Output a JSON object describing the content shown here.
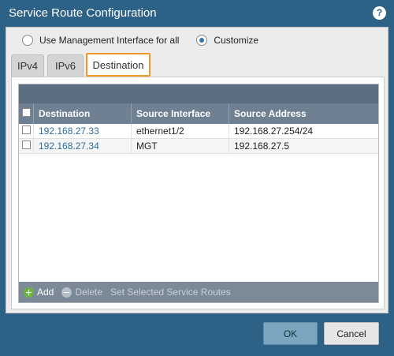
{
  "title": "Service Route Configuration",
  "help_icon": "?",
  "options": {
    "mgmt_label": "Use Management Interface for all",
    "customize_label": "Customize",
    "selected": "customize"
  },
  "tabs": [
    {
      "label": "IPv4"
    },
    {
      "label": "IPv6"
    },
    {
      "label": "Destination"
    }
  ],
  "active_tab": "Destination",
  "table": {
    "columns": [
      "Destination",
      "Source Interface",
      "Source Address"
    ],
    "rows": [
      {
        "destination": "192.168.27.33",
        "source_interface": "ethernet1/2",
        "source_address": "192.168.27.254/24"
      },
      {
        "destination": "192.168.27.34",
        "source_interface": "MGT",
        "source_address": "192.168.27.5"
      }
    ]
  },
  "footer": {
    "add_label": "Add",
    "delete_label": "Delete",
    "set_label": "Set Selected Service Routes"
  },
  "buttons": {
    "ok_label": "OK",
    "cancel_label": "Cancel"
  }
}
